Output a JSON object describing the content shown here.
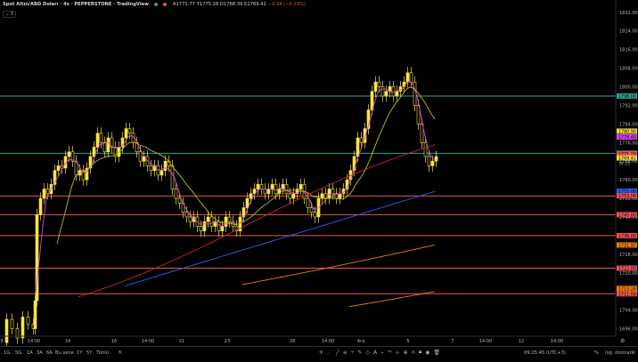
{
  "header": {
    "title": "Spot Altın/ABD Doları · 4s · PEPPERSTONE · TradingView",
    "open": "A1771.77",
    "high": "Y1775.28",
    "low": "D1768.39",
    "close": "K1769.41",
    "change": "−2.34 (−0.13%)",
    "indicators_toggle": "3"
  },
  "price_axis": {
    "ticks": [
      "1832.00",
      "1824.00",
      "1816.00",
      "1808.00",
      "1800.00",
      "1792.00",
      "1784.00",
      "1776.00",
      "1768.00",
      "1760.00",
      "1752.00",
      "1744.00",
      "1736.00",
      "1728.00",
      "1720.00",
      "1712.00",
      "1704.00",
      "1696.00"
    ],
    "top_label": "1832.00",
    "badges": [
      {
        "text": "1796.00",
        "color": "#26a69a"
      },
      {
        "text": "1780.90",
        "color": "#f5d742"
      },
      {
        "text": "1778.40",
        "color": "#e040fb"
      },
      {
        "text": "1771.38",
        "color": "#26a69a"
      },
      {
        "text": "1771.20",
        "color": "#ef5350"
      },
      {
        "text": "1769.41",
        "color": "#f5d742"
      },
      {
        "text": "1755.08",
        "color": "#2962ff"
      },
      {
        "text": "1753.09",
        "color": "#ef5350"
      },
      {
        "text": "1745.00",
        "color": "#ef5350"
      },
      {
        "text": "1736.00",
        "color": "#ef5350"
      },
      {
        "text": "1731.97",
        "color": "#f57c00"
      },
      {
        "text": "1722.00",
        "color": "#ef5350"
      },
      {
        "text": "1713.28",
        "color": "#f57c00"
      },
      {
        "text": "1711.00",
        "color": "#ef5350"
      }
    ],
    "countdown": "34:15"
  },
  "time_axis": {
    "ticks": [
      "9",
      "14:00",
      "14",
      "16",
      "14:00",
      "21",
      "23",
      "28",
      "14:00",
      "Ara",
      "5",
      "7",
      "14:00",
      "12",
      "14:00"
    ]
  },
  "horizontal_lines": [
    {
      "price": 1796.0,
      "color": "#26a69a"
    },
    {
      "price": 1771.38,
      "color": "#26a69a"
    },
    {
      "price": 1753.0,
      "color": "#ef5350"
    },
    {
      "price": 1745.0,
      "color": "#ef5350"
    },
    {
      "price": 1736.0,
      "color": "#ef5350"
    },
    {
      "price": 1722.0,
      "color": "#ef5350"
    },
    {
      "price": 1711.0,
      "color": "#ef5350"
    }
  ],
  "bottom_bar": {
    "ranges": [
      "1G",
      "5G",
      "1A",
      "3A",
      "6A",
      "Bu sene",
      "1Y",
      "5Y",
      "Tümü"
    ],
    "time": "09:25:45 (UTC+3)",
    "percent": "%",
    "log": "log",
    "auto": "otomatik"
  },
  "colors": {
    "candle": "#f5e642",
    "ma_fast": "#e040fb",
    "ma_mid": "#b8c400",
    "ma_slow": "#c62828",
    "ma_blue": "#2962ff",
    "ma_orange": "#f57c00"
  }
}
